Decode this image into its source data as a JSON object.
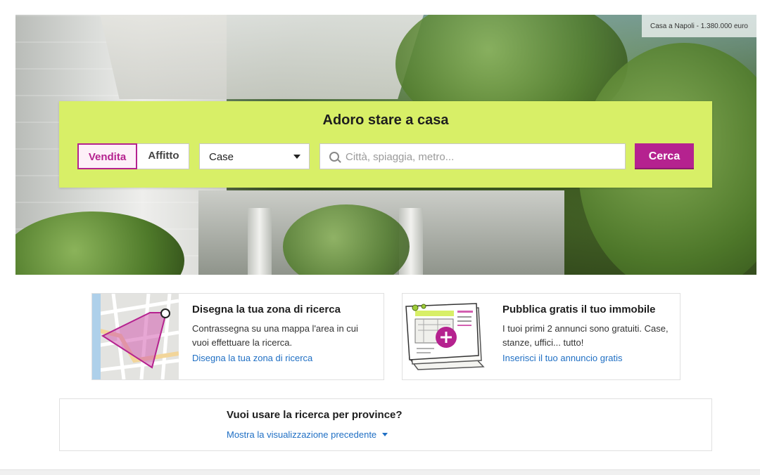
{
  "hero": {
    "caption": "Casa a Napoli - 1.380.000 euro"
  },
  "search": {
    "title": "Adoro stare a casa",
    "tabs": [
      "Vendita",
      "Affitto"
    ],
    "active_tab": "Vendita",
    "type_select": "Case",
    "placeholder": "Città, spiaggia, metro...",
    "button": "Cerca"
  },
  "cards": [
    {
      "title": "Disegna la tua zona di ricerca",
      "description": "Contrassegna su una mappa l'area in cui vuoi effettuare la ricerca.",
      "link": "Disegna la tua zona di ricerca",
      "icon": "map-draw-icon"
    },
    {
      "title": "Pubblica gratis il tuo immobile",
      "description": "I tuoi primi 2 annunci sono gratuiti. Case, stanze, uffici... tutto!",
      "link": "Inserisci il tuo annuncio gratis",
      "icon": "publish-listing-icon"
    }
  ],
  "province": {
    "title": "Vuoi usare la ricerca per province?",
    "link": "Mostra la visualizzazione precedente"
  },
  "colors": {
    "accent": "#b5228f",
    "panel": "#d8ef67",
    "link": "#1f6fc4"
  }
}
